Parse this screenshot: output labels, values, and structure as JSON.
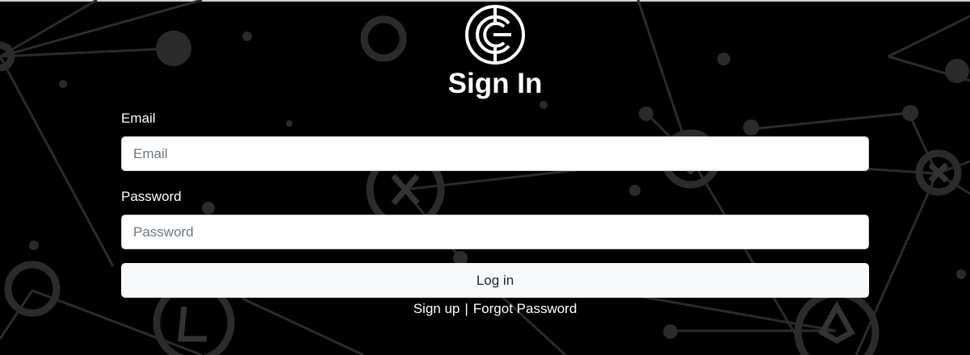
{
  "form": {
    "title": "Sign In",
    "email_label": "Email",
    "email_placeholder": "Email",
    "email_value": "",
    "password_label": "Password",
    "password_placeholder": "Password",
    "password_value": "",
    "login_label": "Log in"
  },
  "links": {
    "signup": "Sign up",
    "separator": "|",
    "forgot": "Forgot Password"
  },
  "colors": {
    "background": "#000000",
    "input_background": "#ffffff",
    "button_background": "#f8f9fa",
    "text": "#ffffff"
  },
  "icons": {
    "logo": "coin-c-logo-icon",
    "background": "crypto-network-background"
  }
}
